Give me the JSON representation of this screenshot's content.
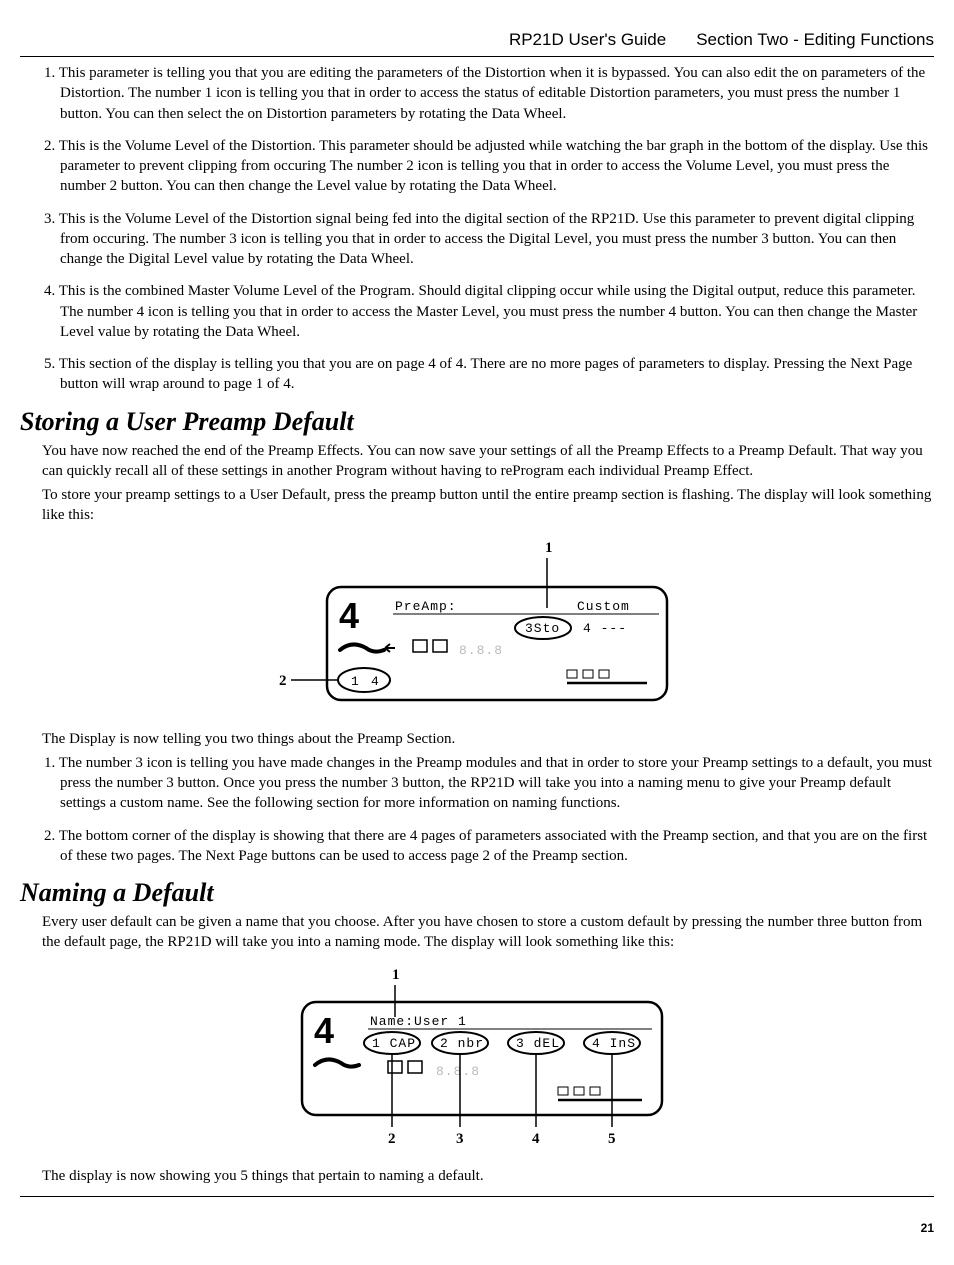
{
  "header": {
    "left": "RP21D User's Guide",
    "right": "Section Two - Editing Functions"
  },
  "list1": [
    {
      "n": "1.",
      "t": "This parameter is telling you that you are editing the parameters of the Distortion when it is bypassed. You can also edit the on parameters of the Distortion. The number 1 icon is telling you that in order to access the status of editable Distortion parameters, you must press the number 1 button. You can then select the on Distortion parameters by rotating the Data Wheel."
    },
    {
      "n": "2.",
      "t": "This is the Volume Level of the Distortion. This parameter should be adjusted while watching the bar graph in the bottom of the display. Use this parameter to prevent clipping from occuring The number 2 icon is telling you that in order to access the Volume Level, you must press the number 2 button. You can then change the Level value by rotating the Data Wheel."
    },
    {
      "n": "3.",
      "t": "This is the Volume Level of the Distortion signal being fed into the digital section of the RP21D.  Use this parameter to prevent digital clipping from occuring. The number 3 icon is telling you that in order to access the Digital Level, you must press the number 3 button. You can then change the Digital Level value by rotating the Data Wheel."
    },
    {
      "n": "4.",
      "t": "This is the combined Master Volume Level of the Program.  Should digital clipping occur while using the Digital output, reduce this parameter. The number 4 icon is telling you that in order to access the Master Level, you must press the number 4 button. You can then change the Master Level value by rotating the Data Wheel."
    },
    {
      "n": "5.",
      "t": "This section of the display is telling you that you are on page 4 of 4. There are no more pages of parameters to display. Pressing the Next Page button will wrap around to page 1 of 4."
    }
  ],
  "section1": {
    "title": "Storing a User Preamp Default",
    "p1": "You have now reached the end of the Preamp Effects. You can now save your settings of all the Preamp Effects to a Preamp Default. That way you can quickly recall all of these settings in another Program without having to reProgram each individual Preamp Effect.",
    "p2": "To store your preamp settings to a User Default, press the preamp button until the entire preamp section is flashing. The display will look something like this:",
    "fig": {
      "callout1": "1",
      "callout2": "2",
      "lcd_left": "PreAmp:",
      "lcd_right": "Custom",
      "lcd_ovalL": "3Sto",
      "lcd_ovalR": "4 ---",
      "page_cur": "1",
      "page_tot": "4"
    },
    "after": "The Display is now telling you two things about the Preamp Section.",
    "list": [
      {
        "n": "1.",
        "t": "The number 3 icon is telling you have made changes in the Preamp modules and that in order to store your Preamp settings to a default, you must press the number 3 button. Once you press the number 3 button, the RP21D will take you into a naming menu to give your Preamp default settings a custom name. See the following section for more information on naming functions."
      },
      {
        "n": "2.",
        "t": "The bottom corner of the display is showing that there are 4 pages of parameters associated with the Preamp section, and that you are on the first of these two pages. The Next Page buttons can be used to access page 2 of the Preamp section."
      }
    ]
  },
  "section2": {
    "title": "Naming a Default",
    "p1": "Every user default can be given a name that you choose. After you have chosen to store a custom default by pressing the number three button from the default page, the RP21D will take you into a naming mode. The display will look something like this:",
    "fig": {
      "callout1": "1",
      "callout2": "2",
      "callout3": "3",
      "callout4": "4",
      "callout5": "5",
      "lcd_top": "Name:User 1",
      "oval1": "1 CAP",
      "oval2": "2 nbr",
      "oval3": "3 dEL",
      "oval4": "4 InS"
    },
    "after": "The display is now showing you 5 things that pertain to naming a default."
  },
  "pagenum": "21"
}
